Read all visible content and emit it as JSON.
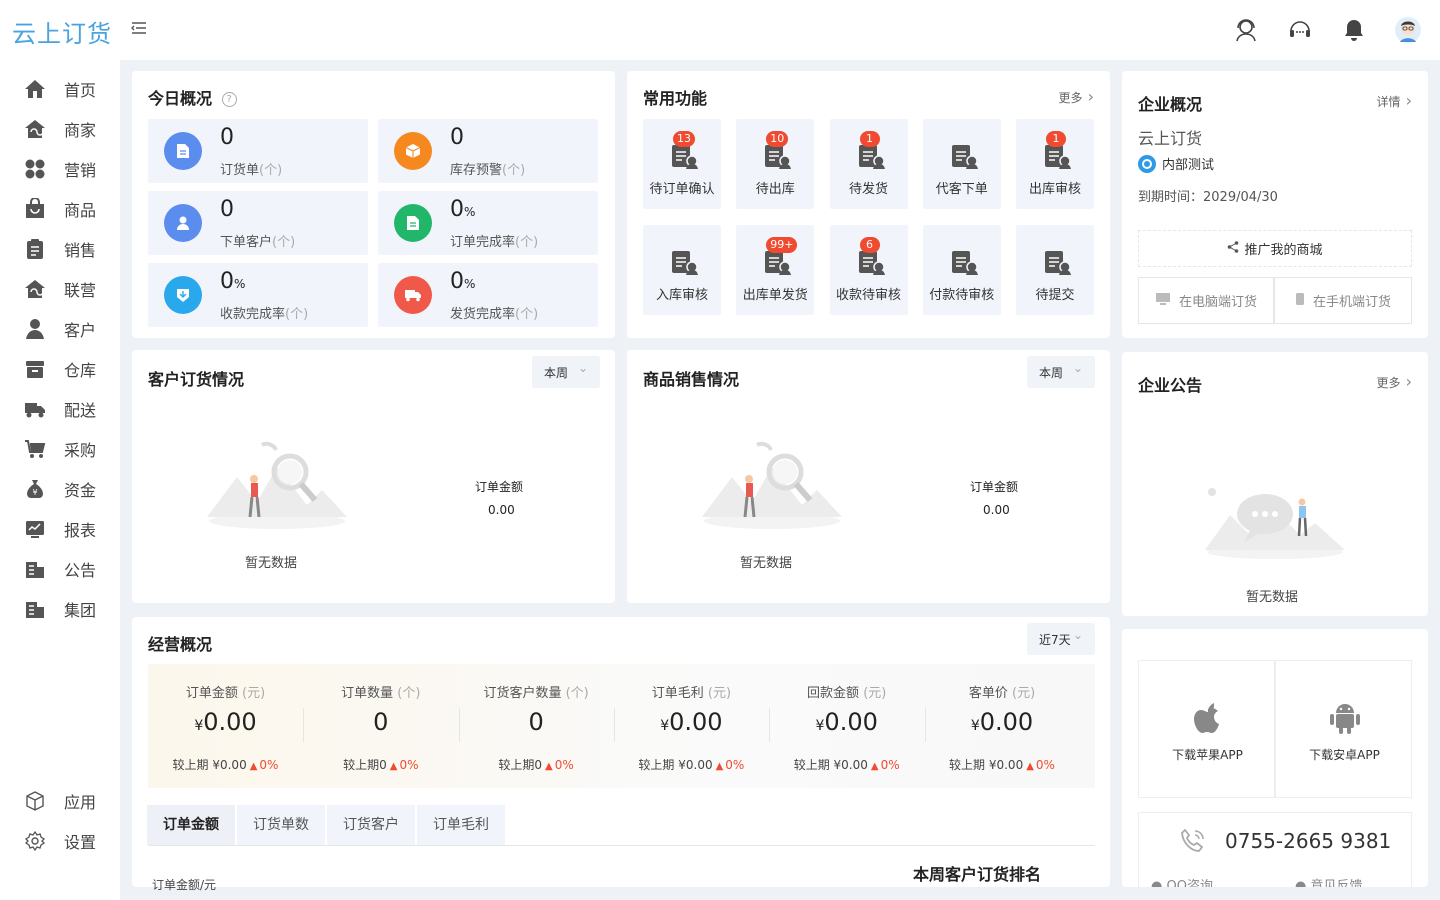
{
  "brand": {
    "logo_text": "云上订货"
  },
  "sidebar": {
    "items": [
      {
        "label": "首页",
        "icon": "home-icon"
      },
      {
        "label": "商家",
        "icon": "merchant-icon"
      },
      {
        "label": "营销",
        "icon": "marketing-icon"
      },
      {
        "label": "商品",
        "icon": "goods-icon"
      },
      {
        "label": "销售",
        "icon": "sales-icon"
      },
      {
        "label": "联营",
        "icon": "joint-icon"
      },
      {
        "label": "客户",
        "icon": "customer-icon"
      },
      {
        "label": "仓库",
        "icon": "warehouse-icon"
      },
      {
        "label": "配送",
        "icon": "truck-icon"
      },
      {
        "label": "采购",
        "icon": "cart-icon"
      },
      {
        "label": "资金",
        "icon": "money-bag-icon"
      },
      {
        "label": "报表",
        "icon": "report-icon"
      },
      {
        "label": "公告",
        "icon": "notice-icon"
      },
      {
        "label": "集团",
        "icon": "group-icon"
      }
    ],
    "bottom": [
      {
        "label": "应用",
        "icon": "cube-icon"
      },
      {
        "label": "设置",
        "icon": "gear-icon"
      }
    ]
  },
  "today": {
    "title": "今日概况",
    "stats": [
      {
        "value": "0",
        "unit": "",
        "label": "订货单",
        "sub": "(个)",
        "color": "#5b8def"
      },
      {
        "value": "0",
        "unit": "",
        "label": "库存预警",
        "sub": "(个)",
        "color": "#f5891f"
      },
      {
        "value": "0",
        "unit": "",
        "label": "下单客户",
        "sub": "(个)",
        "color": "#5b8def"
      },
      {
        "value": "0",
        "unit": "%",
        "label": "订单完成率",
        "sub": "(个)",
        "color": "#22b66a"
      },
      {
        "value": "0",
        "unit": "%",
        "label": "收款完成率",
        "sub": "(个)",
        "color": "#29a9ec"
      },
      {
        "value": "0",
        "unit": "%",
        "label": "发货完成率",
        "sub": "(个)",
        "color": "#f0584a"
      }
    ]
  },
  "functions": {
    "title": "常用功能",
    "more": "更多",
    "items": [
      {
        "label": "待订单确认",
        "badge": "13"
      },
      {
        "label": "待出库",
        "badge": "10"
      },
      {
        "label": "待发货",
        "badge": "1"
      },
      {
        "label": "代客下单",
        "badge": ""
      },
      {
        "label": "出库审核",
        "badge": "1"
      },
      {
        "label": "入库审核",
        "badge": ""
      },
      {
        "label": "出库单发货",
        "badge": "99+"
      },
      {
        "label": "收款待审核",
        "badge": "6"
      },
      {
        "label": "付款待审核",
        "badge": ""
      },
      {
        "label": "待提交",
        "badge": ""
      }
    ]
  },
  "company": {
    "title": "企业概况",
    "more": "详情",
    "name": "云上订货",
    "tag": "内部测试",
    "expire": "到期时间：2029/04/30",
    "promote": "推广我的商城",
    "pc": "在电脑端订货",
    "mobile": "在手机端订货"
  },
  "customer_orders": {
    "title": "客户订货情况",
    "filter": "本周",
    "metric_label": "订单金额",
    "metric_value": "0.00",
    "empty": "暂无数据"
  },
  "goods_sales": {
    "title": "商品销售情况",
    "filter": "本周",
    "metric_label": "订单金额",
    "metric_value": "0.00",
    "empty": "暂无数据"
  },
  "notice": {
    "title": "企业公告",
    "more": "更多",
    "empty": "暂无数据"
  },
  "business": {
    "title": "经营概况",
    "filter": "近7天",
    "kpis": [
      {
        "title": "订单金额",
        "unit": "(元)",
        "currency": "¥",
        "value": "0.00",
        "compare": "较上期 ¥0.00",
        "pct": "0%"
      },
      {
        "title": "订单数量",
        "unit": "(个)",
        "currency": "",
        "value": "0",
        "compare": "较上期0",
        "pct": "0%"
      },
      {
        "title": "订货客户数量",
        "unit": "(个)",
        "currency": "",
        "value": "0",
        "compare": "较上期0",
        "pct": "0%"
      },
      {
        "title": "订单毛利",
        "unit": "(元)",
        "currency": "¥",
        "value": "0.00",
        "compare": "较上期 ¥0.00",
        "pct": "0%"
      },
      {
        "title": "回款金额",
        "unit": "(元)",
        "currency": "¥",
        "value": "0.00",
        "compare": "较上期 ¥0.00",
        "pct": "0%"
      },
      {
        "title": "客单价",
        "unit": "(元)",
        "currency": "¥",
        "value": "0.00",
        "compare": "较上期 ¥0.00",
        "pct": "0%"
      }
    ],
    "tabs": [
      "订单金额",
      "订货单数",
      "订货客户",
      "订单毛利"
    ],
    "chart_ylabel": "订单金额/元",
    "ranking_title": "本周客户订货排名"
  },
  "apps": {
    "ios": "下载苹果APP",
    "android": "下载安卓APP",
    "phone": "0755-2665 9381",
    "qq": "QQ咨询",
    "feedback": "意见反馈"
  },
  "colors": {
    "accent": "#4aa3df",
    "badge": "#f04a30",
    "up": "#f04a30"
  }
}
